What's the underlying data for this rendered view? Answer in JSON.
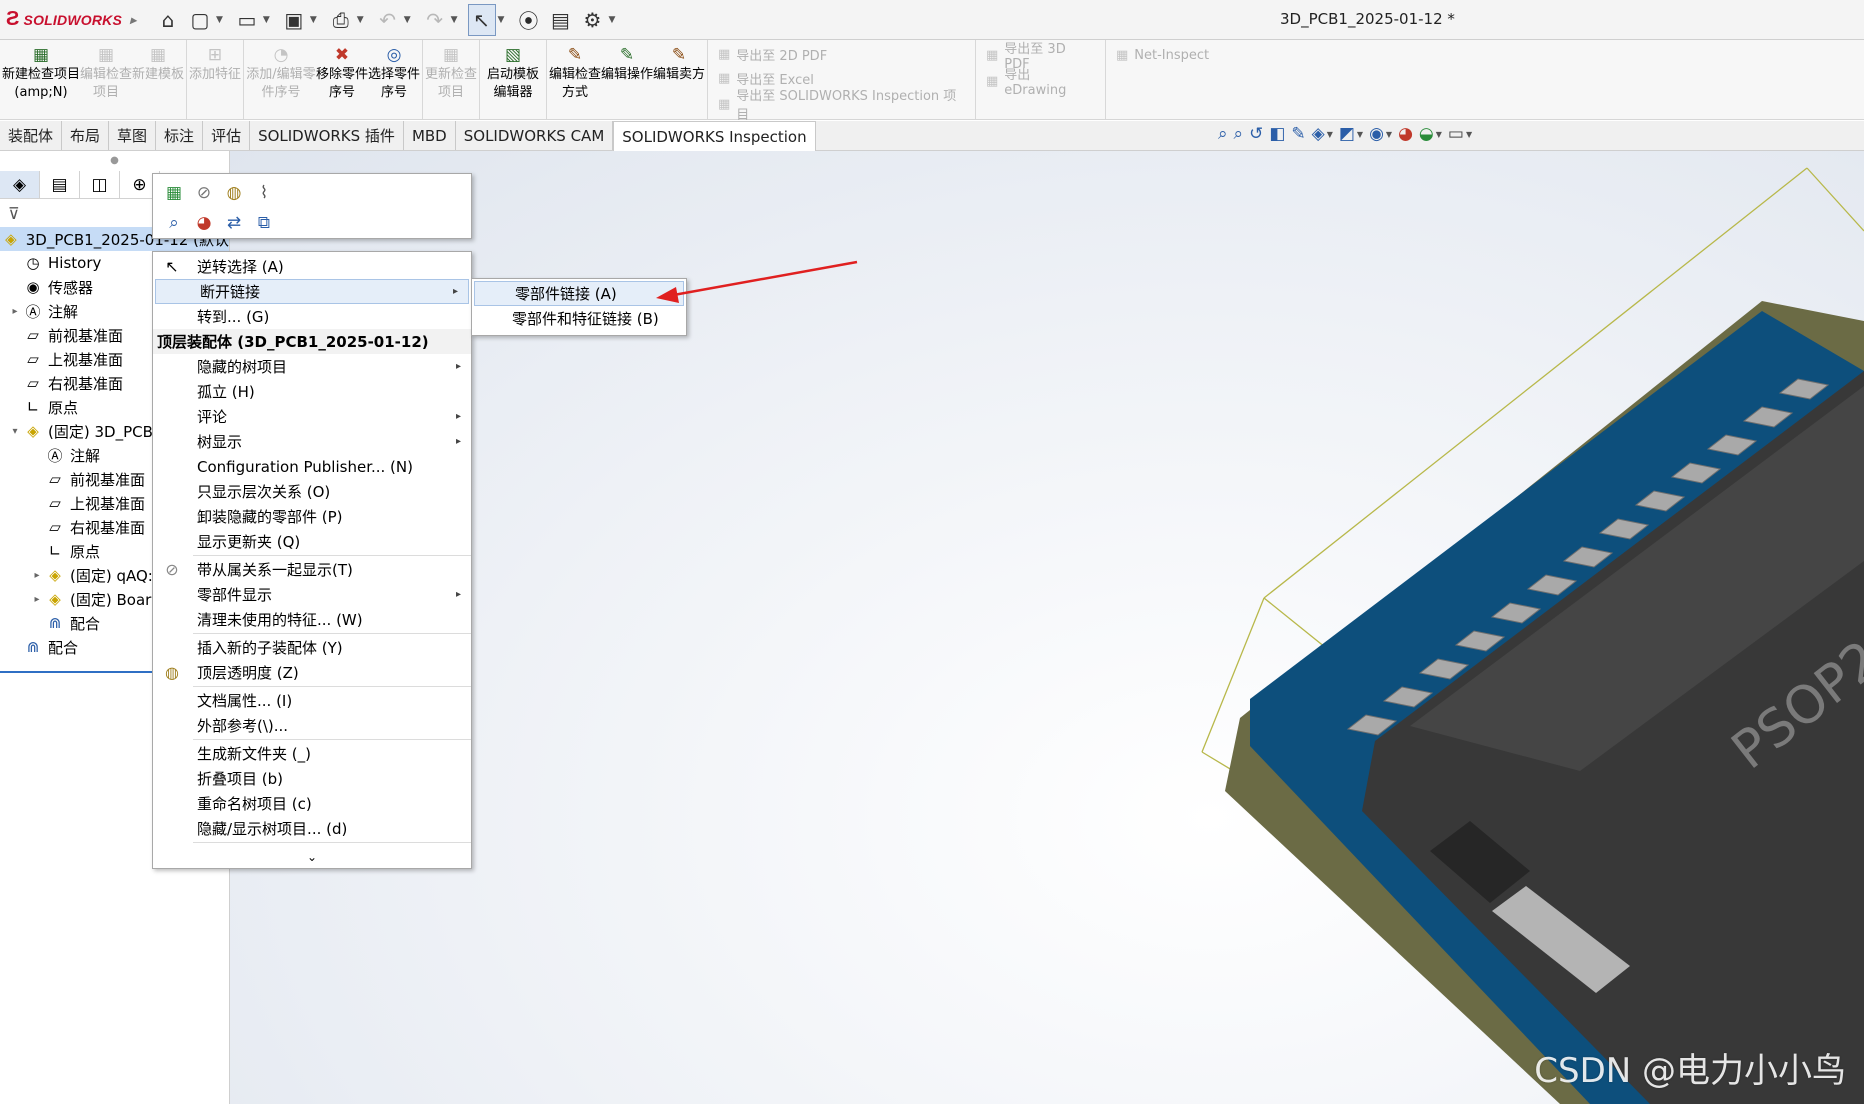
{
  "app": {
    "logo_text": "SOLIDWORKS",
    "document_title": "3D_PCB1_2025-01-12 *"
  },
  "quick_access": [
    {
      "name": "home",
      "glyph": "⌂"
    },
    {
      "name": "new",
      "glyph": "🗋"
    },
    {
      "name": "open",
      "glyph": "📂"
    },
    {
      "name": "save",
      "glyph": "💾"
    },
    {
      "name": "print",
      "glyph": "🖶"
    },
    {
      "name": "undo",
      "glyph": "↶"
    },
    {
      "name": "redo",
      "glyph": "↷"
    },
    {
      "name": "select",
      "glyph": "↖"
    },
    {
      "name": "rebuild",
      "glyph": "🚦"
    },
    {
      "name": "file-properties",
      "glyph": "▤"
    },
    {
      "name": "options",
      "glyph": "⚙"
    }
  ],
  "ribbon": {
    "new_inspection": "新建检查项目(amp;N)",
    "edit_inspection": "编辑检查项目",
    "new_template": "新建模板",
    "add_feature": "添加特征",
    "add_edit_balloon": "添加/编辑零件序号",
    "remove_balloon": "移除零件序号",
    "select_balloon": "选择零件序号",
    "update_inspection": "更新检查项目",
    "launch_template_editor": "启动模板编辑器",
    "edit_inspection_method": "编辑检查方式",
    "edit_operation": "编辑操作",
    "edit_vendor": "编辑卖方",
    "export_2d_pdf": "导出至 2D PDF",
    "export_excel": "导出至 Excel",
    "export_inspection_project": "导出至 SOLIDWORKS Inspection 项目",
    "export_3d_pdf": "导出至 3D PDF",
    "export_edrawing": "导出 eDrawing",
    "net_inspect": "Net-Inspect"
  },
  "tabs": [
    "装配体",
    "布局",
    "草图",
    "标注",
    "评估",
    "SOLIDWORKS 插件",
    "MBD",
    "SOLIDWORKS CAM",
    "SOLIDWORKS Inspection"
  ],
  "tree": {
    "root": "3D_PCB1_2025-01-12 (默认",
    "history": "History",
    "sensors": "传感器",
    "annotations": "注解",
    "front_plane": "前视基准面",
    "top_plane": "上视基准面",
    "right_plane": "右视基准面",
    "origin": "原点",
    "sub_assembly": "(固定) 3D_PCB",
    "sub_annotations": "注解",
    "sub_front_plane": "前视基准面",
    "sub_top_plane": "上视基准面",
    "sub_right_plane": "右视基准面",
    "sub_origin": "原点",
    "part_qaq": "(固定) qAQ:",
    "part_board": "(固定) Boar",
    "sub_mates": "配合",
    "mates": "配合"
  },
  "context_menu": {
    "invert_selection": "逆转选择 (A)",
    "break_links": "断开链接",
    "goto": "转到... (G)",
    "header": "顶层装配体 (3D_PCB1_2025-01-12)",
    "hidden_tree_items": "隐藏的树项目",
    "isolate": "孤立 (H)",
    "comment": "评论",
    "tree_display": "树显示",
    "config_publisher": "Configuration Publisher... (N)",
    "show_hierarchy_only": "只显示层次关系 (O)",
    "unload_hidden": "卸装隐藏的零部件 (P)",
    "show_update_folder": "显示更新夹 (Q)",
    "show_with_dependents": "带从属关系一起显示(T)",
    "component_display": "零部件显示",
    "clean_unused": "清理未使用的特征... (W)",
    "insert_subassembly": "插入新的子装配体 (Y)",
    "top_transparency": "顶层透明度 (Z)",
    "doc_properties": "文档属性... (I)",
    "external_refs": "外部参考(\\)...",
    "new_folder": "生成新文件夹 (_)",
    "collapse": "折叠项目 (b)",
    "rename": "重命名树项目 (c)",
    "hide_show_tree": "隐藏/显示树项目... (d)",
    "more": "⌄"
  },
  "submenu": {
    "component_links": "零部件链接 (A)",
    "component_feature_links": "零部件和特征链接 (B)"
  },
  "viewport": {
    "chip_label": "PSOP2",
    "watermark": "CSDN @电力小小鸟"
  },
  "colors": {
    "brand": "#c8102e",
    "pcb": "#0d4f7c",
    "chip": "#3a3a3a",
    "arrow": "#e02020",
    "selection": "#c6dcf6"
  }
}
